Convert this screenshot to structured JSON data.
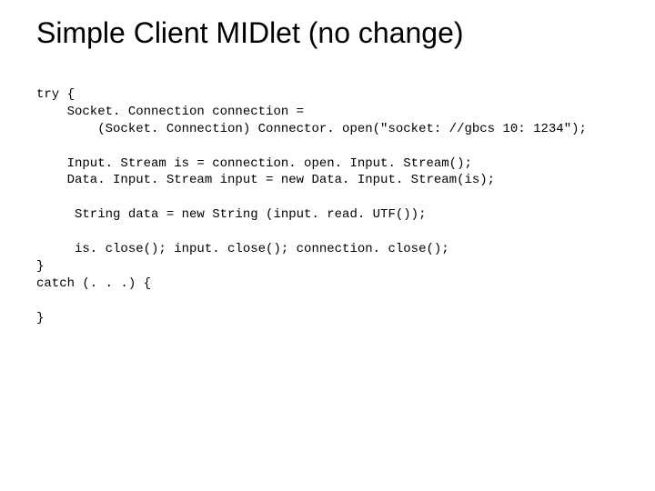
{
  "title": "Simple Client MIDlet (no change)",
  "code": {
    "l1": "try {",
    "l2": "    Socket. Connection connection =",
    "l3": "        (Socket. Connection) Connector. open(\"socket: //gbcs 10: 1234\");",
    "l4": "",
    "l5": "    Input. Stream is = connection. open. Input. Stream();",
    "l6": "    Data. Input. Stream input = new Data. Input. Stream(is);",
    "l7": "",
    "l8": "     String data = new String (input. read. UTF());",
    "l9": "",
    "l10": "     is. close(); input. close(); connection. close();",
    "l11": "}",
    "l12": "catch (. . .) {",
    "l13": "",
    "l14": "}"
  }
}
